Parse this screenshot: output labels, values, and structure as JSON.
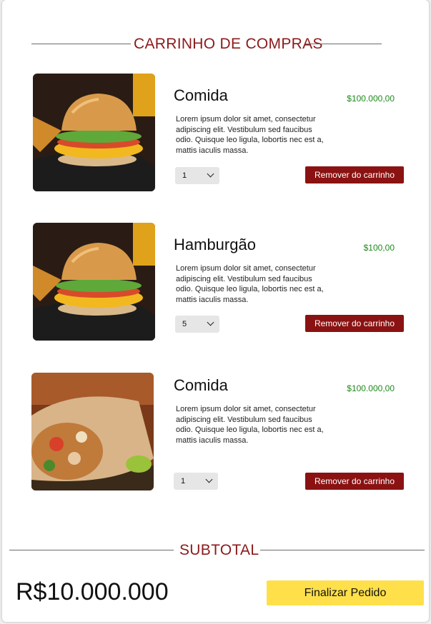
{
  "cart": {
    "title": "CARRINHO DE COMPRAS",
    "remove_label": "Remover do carrinho",
    "items": [
      {
        "name": "Comida",
        "price": "$100.000,00",
        "description": "Lorem ipsum dolor sit amet, consectetur adipiscing elit. Vestibulum sed faucibus odio. Quisque leo ligula, lobortis nec est a, mattis iaculis massa.",
        "quantity": "1",
        "image": "burger-image"
      },
      {
        "name": "Hamburgão",
        "price": "$100,00",
        "description": "Lorem ipsum dolor sit amet, consectetur adipiscing elit. Vestibulum sed faucibus odio. Quisque leo ligula, lobortis nec est a, mattis iaculis massa.",
        "quantity": "5",
        "image": "burger-image"
      },
      {
        "name": "Comida",
        "price": "$100.000,00",
        "description": "Lorem ipsum dolor sit amet, consectetur adipiscing elit. Vestibulum sed faucibus odio. Quisque leo ligula, lobortis nec est a, mattis iaculis massa.",
        "quantity": "1",
        "image": "burrito-image"
      }
    ]
  },
  "subtotal": {
    "title": "SUBTOTAL",
    "value": "R$10.000.000",
    "finish_label": "Finalizar Pedido"
  },
  "colors": {
    "accent": "#8b1a1a",
    "price": "#1f8a1f",
    "remove_button": "#8b1212",
    "finish_button": "#ffe04a"
  }
}
